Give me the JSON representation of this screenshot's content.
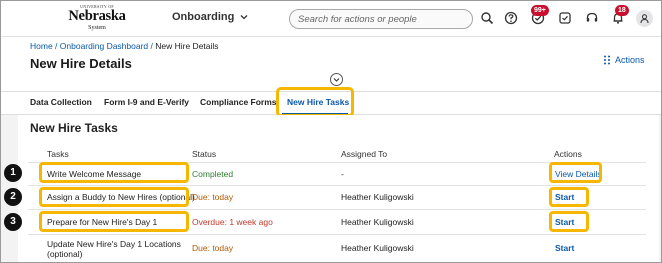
{
  "header": {
    "logo": {
      "sup": "UNIVERSITY OF",
      "main": "Nebraska",
      "sub": "System"
    },
    "module_menu": "Onboarding",
    "search_placeholder": "Search for actions or people",
    "badges": {
      "approvals": "99+",
      "notifications": "18"
    },
    "icons": [
      "search-icon",
      "help-icon",
      "approvals-icon",
      "tasks-icon",
      "support-icon",
      "notifications-icon",
      "user-icon"
    ]
  },
  "breadcrumb": {
    "items": [
      "Home",
      "Onboarding Dashboard"
    ],
    "current": "New Hire Details",
    "separator": " / "
  },
  "page": {
    "title": "New Hire Details",
    "actions_label": "Actions"
  },
  "tabs": [
    {
      "label": "Data Collection"
    },
    {
      "label": "Form I-9 and E-Verify"
    },
    {
      "label": "Compliance Forms"
    },
    {
      "label": "New Hire Tasks",
      "active": true
    }
  ],
  "section": {
    "title": "New Hire Tasks",
    "columns": [
      "Tasks",
      "Status",
      "Assigned To",
      "Actions"
    ],
    "rows": [
      {
        "task": "Write Welcome Message",
        "status": "Completed",
        "assigned_to": "-",
        "action": "View Details"
      },
      {
        "task": "Assign a Buddy to New Hires (optional)",
        "status": "Due: today",
        "assigned_to": "Heather Kuligowski",
        "action": "Start"
      },
      {
        "task": "Prepare for New Hire's Day 1",
        "status": "Overdue: 1 week ago",
        "assigned_to": "Heather Kuligowski",
        "action": "Start"
      },
      {
        "task": "Update New Hire's Day 1 Locations (optional)",
        "status": "Due: today",
        "assigned_to": "Heather Kuligowski",
        "action": "Start"
      }
    ]
  },
  "callouts": [
    "1",
    "2",
    "3"
  ],
  "colors": {
    "link": "#0a58a8",
    "highlight": "#f5b700",
    "completed": "#2e7d32",
    "due": "#b35a00",
    "overdue": "#c0392b",
    "badge": "#c8102e"
  }
}
